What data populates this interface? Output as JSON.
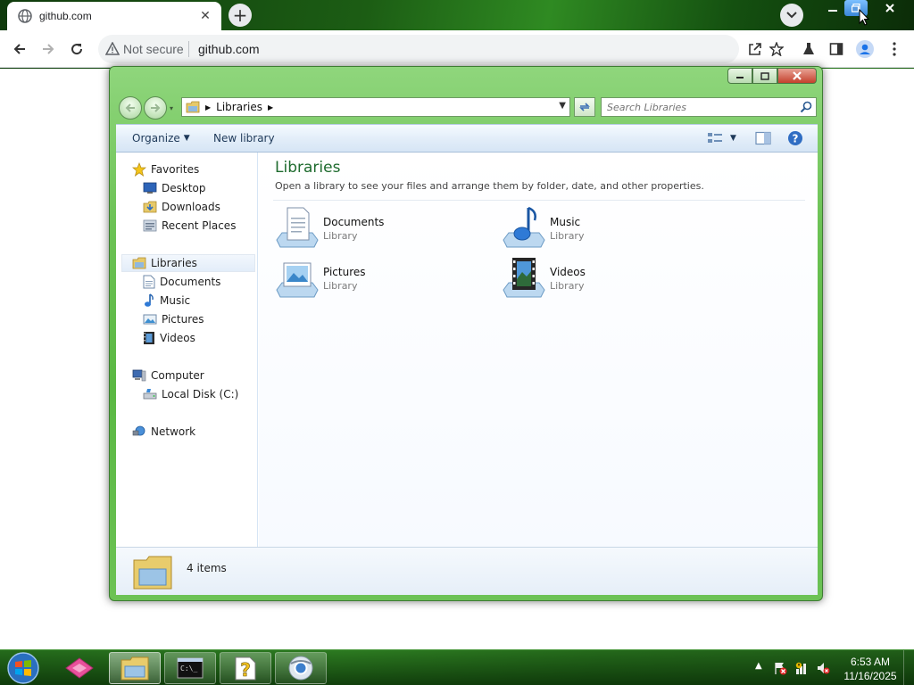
{
  "browser": {
    "tab_title": "github.com",
    "security_label": "Not secure",
    "url": "github.com"
  },
  "explorer": {
    "breadcrumb": [
      "Libraries"
    ],
    "search_placeholder": "Search Libraries",
    "commands": {
      "organize": "Organize",
      "new_library": "New library"
    },
    "nav": {
      "favorites": "Favorites",
      "favorites_items": [
        "Desktop",
        "Downloads",
        "Recent Places"
      ],
      "libraries": "Libraries",
      "libraries_items": [
        "Documents",
        "Music",
        "Pictures",
        "Videos"
      ],
      "computer": "Computer",
      "computer_items": [
        "Local Disk (C:)"
      ],
      "network": "Network"
    },
    "content": {
      "title": "Libraries",
      "subtitle": "Open a library to see your files and arrange them by folder, date, and other properties.",
      "items": [
        {
          "name": "Documents",
          "type": "Library",
          "icon": "documents-library-icon"
        },
        {
          "name": "Music",
          "type": "Library",
          "icon": "music-library-icon"
        },
        {
          "name": "Pictures",
          "type": "Library",
          "icon": "pictures-library-icon"
        },
        {
          "name": "Videos",
          "type": "Library",
          "icon": "videos-library-icon"
        }
      ]
    },
    "details": {
      "count": "4 items"
    }
  },
  "taskbar": {
    "apps": [
      "start-orb",
      "app-pink",
      "explorer",
      "cmd",
      "help",
      "browser"
    ],
    "clock_time": "6:53 AM",
    "clock_date": "11/16/2025"
  }
}
